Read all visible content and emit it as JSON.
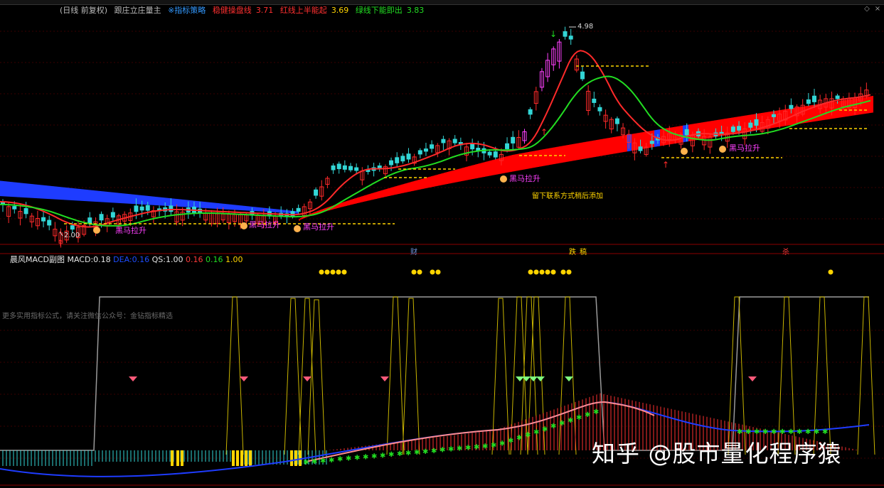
{
  "header": {
    "period_label": "(日线 前复权)",
    "indicator_name": "跟庄立庄量主",
    "strategy_label": "※指标策略",
    "line1_label": "稳健操盘线",
    "line1_value": "3.71",
    "line2_label": "红线上半能起",
    "line2_value": "3.69",
    "line3_label": "绿线下能即出",
    "line3_value": "3.83"
  },
  "price_panel": {
    "high_label": "4.98",
    "low_label": "2.00",
    "contact_text": "留下联系方式稍后添加",
    "signal_label": "黑马拉升",
    "bottom_markers": [
      "财",
      "跌",
      "稿",
      "杀"
    ]
  },
  "sub_header": {
    "name": "晨风MACD副图",
    "macd_label": "MACD:",
    "macd_value": "0.18",
    "dea_label": "DEA:",
    "dea_value": "0.16",
    "qs_label": "QS:",
    "qs_value": "1.00",
    "v1": "0.16",
    "v2": "0.16",
    "v3": "1.00"
  },
  "sub_panel": {
    "note_text": "更多实用指标公式，请关注微信公众号：金钻指标精选"
  },
  "watermark": "知乎 @股市量化程序猿",
  "colors": {
    "up": "#ff2a2a",
    "down": "#33d6d6",
    "ma_red": "#ff2a2a",
    "ma_green": "#22dd22",
    "band_blue": "#1e3cff",
    "band_red": "#ff0000",
    "yellow": "#ffd400",
    "magenta": "#ff40ff"
  },
  "chart_data": {
    "type": "line",
    "title": "跟庄立庄量主",
    "price_high": 4.98,
    "price_low": 2.0,
    "series": [
      {
        "name": "稳健操盘线",
        "last_value": 3.71
      },
      {
        "name": "红线上半能起",
        "last_value": 3.69
      },
      {
        "name": "绿线下能即出",
        "last_value": 3.83
      }
    ],
    "sub_chart": {
      "name": "晨风MACD副图",
      "MACD": 0.18,
      "DEA": 0.16,
      "QS": 1.0
    }
  }
}
